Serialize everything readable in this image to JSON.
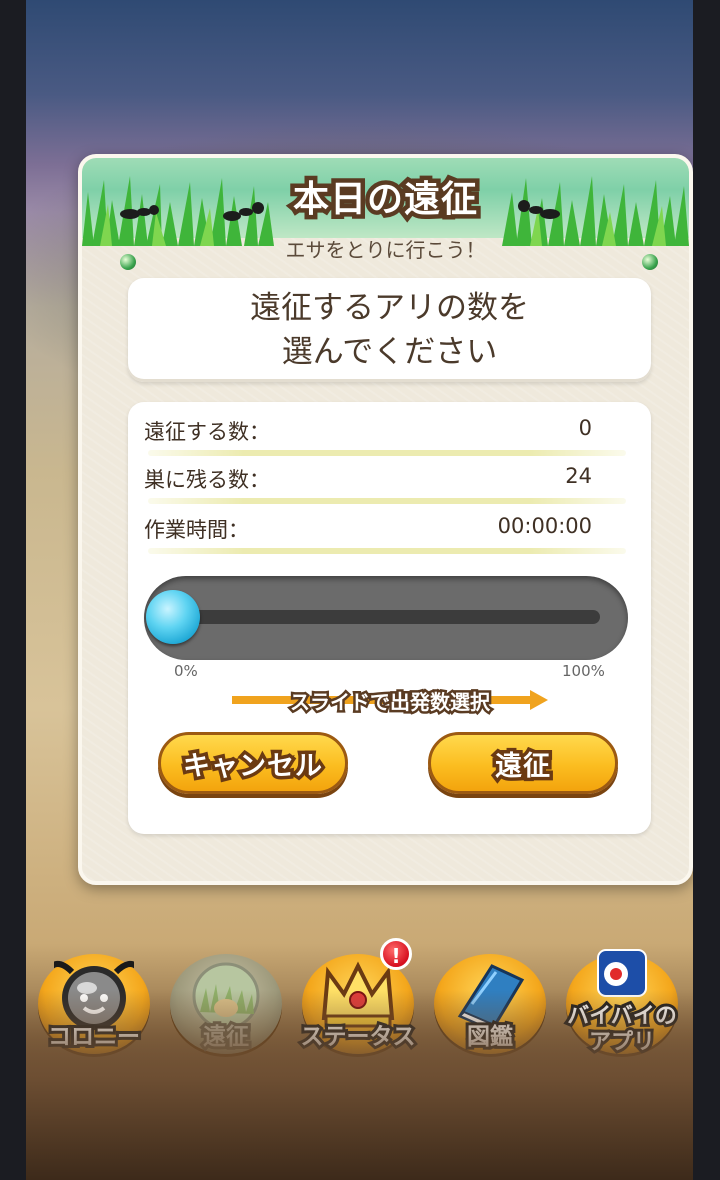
{
  "dialog": {
    "title": "本日の遠征",
    "subtitle": "エサをとりに行こう！",
    "instruction_line1": "遠征するアリの数を",
    "instruction_line2": "選んでください"
  },
  "stats": [
    {
      "label": "遠征する数：",
      "value": "0"
    },
    {
      "label": "巣に残る数：",
      "value": "24"
    },
    {
      "label": "作業時間：",
      "value": "00:00:00"
    }
  ],
  "slider": {
    "min_label": "0%",
    "max_label": "100%",
    "value_fraction": 0.0,
    "hint": "スライドで出発数選択"
  },
  "buttons": {
    "cancel": "キャンセル",
    "confirm": "遠征"
  },
  "nav": [
    {
      "label": "コロニー",
      "icon": "ant-face-icon"
    },
    {
      "label": "遠征",
      "icon": "expedition-icon",
      "disabled": true
    },
    {
      "label": "ステータス",
      "icon": "crown-icon",
      "badge": "!"
    },
    {
      "label": "図鑑",
      "icon": "book-icon"
    },
    {
      "label": "バイバイの\nアプリ",
      "icon": "app-icon"
    }
  ],
  "colors": {
    "button_yellow": "#fbbd20",
    "text_brown": "#4b3a2b",
    "slider_knob": "#20a9d6",
    "hint_arrow": "#f0a31e"
  }
}
